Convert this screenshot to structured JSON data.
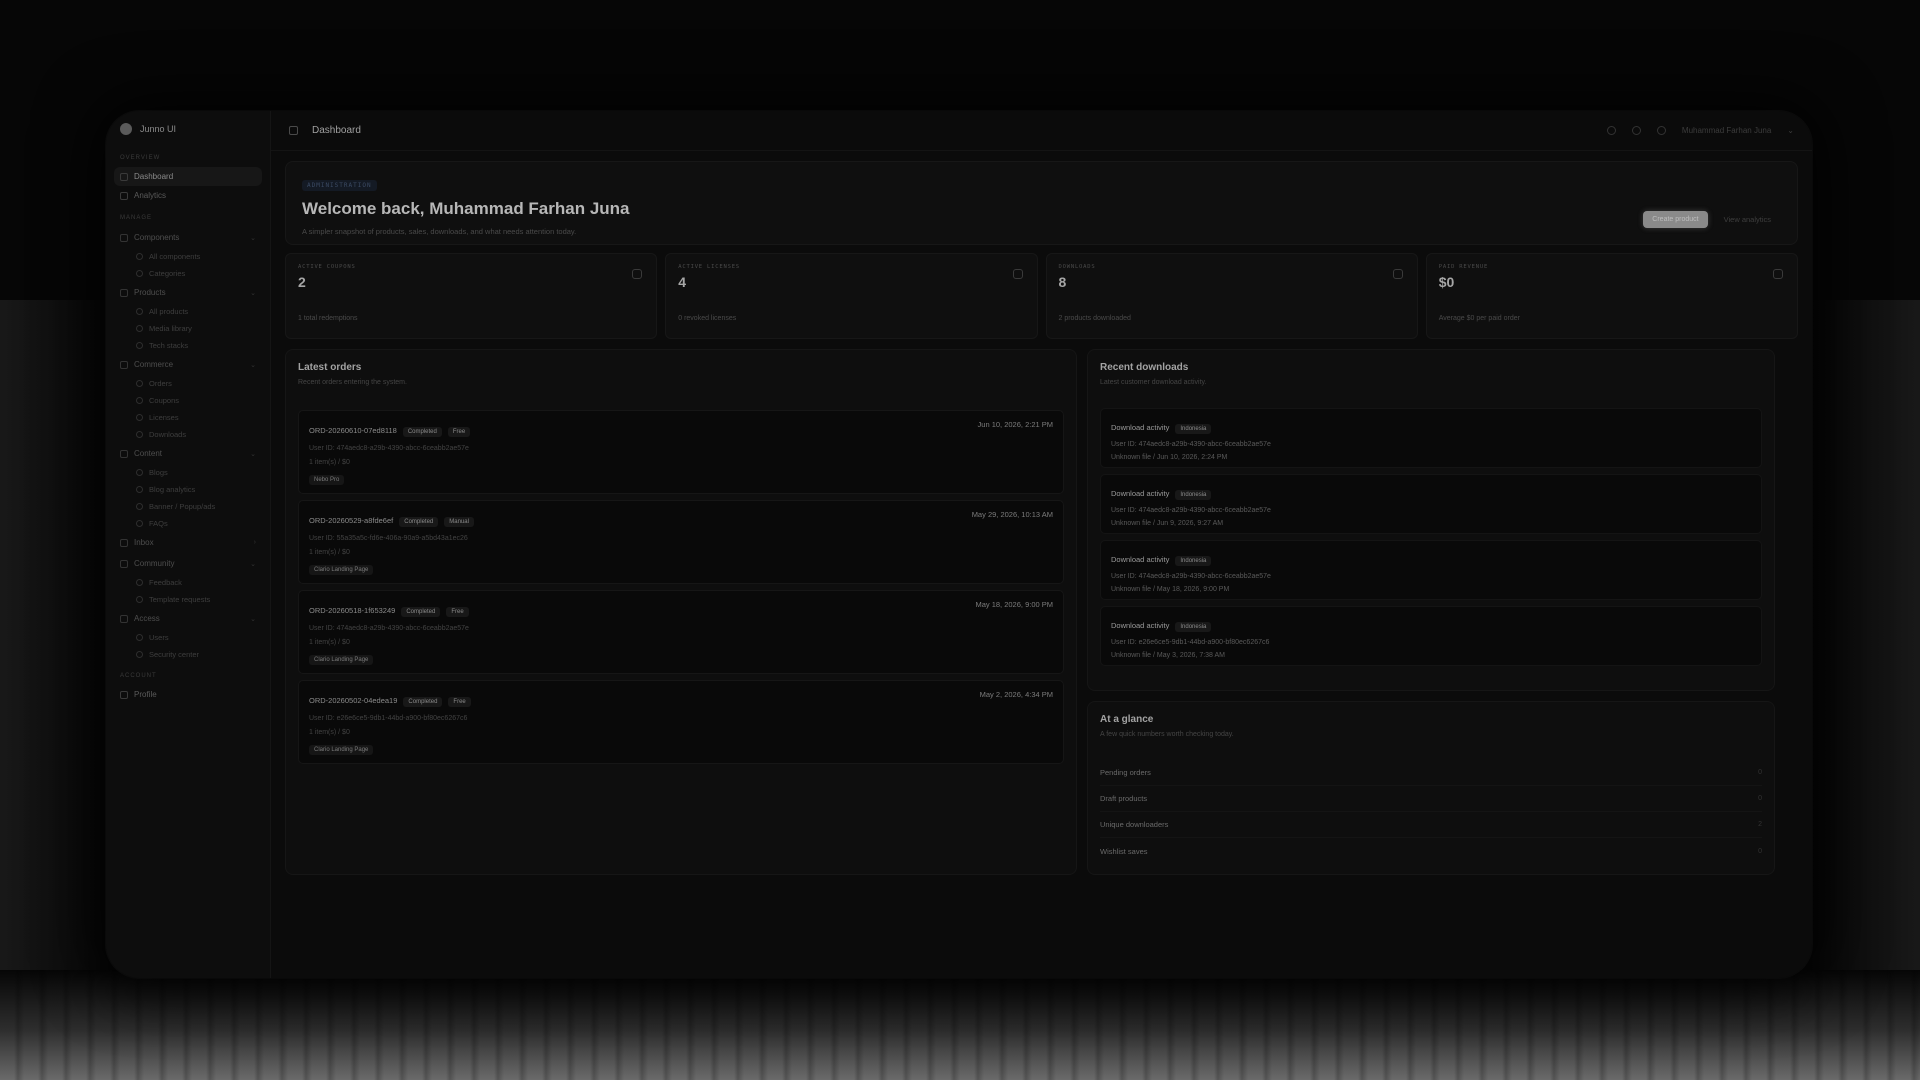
{
  "sidebar": {
    "brand": "Junno UI",
    "sections": {
      "overview": "Overview",
      "manage": "Manage",
      "account": "Account"
    },
    "overview_items": [
      {
        "label": "Dashboard"
      },
      {
        "label": "Analytics"
      }
    ],
    "groups": [
      {
        "label": "Components",
        "items": [
          "All components",
          "Categories"
        ]
      },
      {
        "label": "Products",
        "items": [
          "All products",
          "Media library",
          "Tech stacks"
        ]
      },
      {
        "label": "Commerce",
        "items": [
          "Orders",
          "Coupons",
          "Licenses",
          "Downloads"
        ]
      },
      {
        "label": "Content",
        "items": [
          "Blogs",
          "Blog analytics",
          "Banner / Popup/ads",
          "FAQs"
        ]
      },
      {
        "label": "Inbox",
        "items": []
      },
      {
        "label": "Community",
        "items": [
          "Feedback",
          "Template requests"
        ]
      },
      {
        "label": "Access",
        "items": [
          "Users",
          "Security center"
        ]
      }
    ],
    "account_items": [
      {
        "label": "Profile"
      }
    ]
  },
  "topbar": {
    "title": "Dashboard",
    "user": "Muhammad Farhan Juna"
  },
  "hero": {
    "badge": "Administration",
    "title": "Welcome back, Muhammad Farhan Juna",
    "subtitle": "A simpler snapshot of products, sales, downloads, and what needs attention today.",
    "primary_button": "Create product",
    "secondary_button": "View analytics"
  },
  "stats": [
    {
      "label": "Active coupons",
      "value": "2",
      "foot": "1 total redemptions",
      "icon": "ticket-icon"
    },
    {
      "label": "Active licenses",
      "value": "4",
      "foot": "0 revoked licenses",
      "icon": "key-icon"
    },
    {
      "label": "Downloads",
      "value": "8",
      "foot": "2 products downloaded",
      "icon": "download-icon"
    },
    {
      "label": "Paid revenue",
      "value": "$0",
      "foot": "Average $0 per paid order",
      "icon": "dollar-icon"
    }
  ],
  "orders": {
    "title": "Latest orders",
    "desc": "Recent orders entering the system.",
    "items": [
      {
        "id": "ORD-20260610-07ed8118",
        "status": "Completed",
        "type": "Free",
        "date": "Jun 10, 2026, 2:21 PM",
        "user": "User ID: 474aedc8-a29b-4390-abcc-6ceabb2ae57e",
        "summary": "1 item(s) / $0",
        "tag": "Nebo Pro"
      },
      {
        "id": "ORD-20260529-a8fde6ef",
        "status": "Completed",
        "type": "Manual",
        "date": "May 29, 2026, 10:13 AM",
        "user": "User ID: 55a35a5c-fd6e-406a-90a9-a5bd43a1ec26",
        "summary": "1 item(s) / $0",
        "tag": "Clario Landing Page"
      },
      {
        "id": "ORD-20260518-1f653249",
        "status": "Completed",
        "type": "Free",
        "date": "May 18, 2026, 9:00 PM",
        "user": "User ID: 474aedc8-a29b-4390-abcc-6ceabb2ae57e",
        "summary": "1 item(s) / $0",
        "tag": "Clario Landing Page"
      },
      {
        "id": "ORD-20260502-04edea19",
        "status": "Completed",
        "type": "Free",
        "date": "May 2, 2026, 4:34 PM",
        "user": "User ID: e26e6ce5-9db1-44bd-a900-bf80ec6267c6",
        "summary": "1 item(s) / $0",
        "tag": "Clario Landing Page"
      }
    ]
  },
  "downloads": {
    "title": "Recent downloads",
    "desc": "Latest customer download activity.",
    "items": [
      {
        "title": "Download activity",
        "country": "Indonesia",
        "user": "User ID: 474aedc8-a29b-4390-abcc-6ceabb2ae57e",
        "file": "Unknown file / Jun 10, 2026, 2:24 PM"
      },
      {
        "title": "Download activity",
        "country": "Indonesia",
        "user": "User ID: 474aedc8-a29b-4390-abcc-6ceabb2ae57e",
        "file": "Unknown file / Jun 9, 2026, 9:27 AM"
      },
      {
        "title": "Download activity",
        "country": "Indonesia",
        "user": "User ID: 474aedc8-a29b-4390-abcc-6ceabb2ae57e",
        "file": "Unknown file / May 18, 2026, 9:00 PM"
      },
      {
        "title": "Download activity",
        "country": "Indonesia",
        "user": "User ID: e26e6ce5-9db1-44bd-a900-bf80ec6267c6",
        "file": "Unknown file / May 3, 2026, 7:38 AM"
      }
    ]
  },
  "glance": {
    "title": "At a glance",
    "desc": "A few quick numbers worth checking today.",
    "rows": [
      {
        "label": "Pending orders",
        "value": "0"
      },
      {
        "label": "Draft products",
        "value": "0"
      },
      {
        "label": "Unique downloaders",
        "value": "2"
      },
      {
        "label": "Wishlist saves",
        "value": "0"
      }
    ]
  }
}
